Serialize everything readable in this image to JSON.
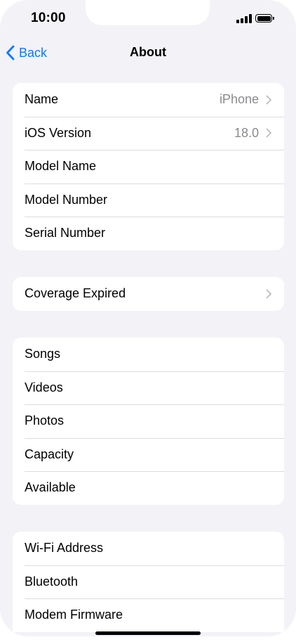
{
  "status_bar": {
    "time": "10:00"
  },
  "nav": {
    "back_label": "Back",
    "title": "About"
  },
  "groups": [
    {
      "rows": [
        {
          "label": "Name",
          "value": "iPhone",
          "chevron": true
        },
        {
          "label": "iOS Version",
          "value": "18.0",
          "chevron": true
        },
        {
          "label": "Model Name",
          "value": "",
          "chevron": false
        },
        {
          "label": "Model Number",
          "value": "",
          "chevron": false
        },
        {
          "label": "Serial Number",
          "value": "",
          "chevron": false
        }
      ]
    },
    {
      "rows": [
        {
          "label": "Coverage Expired",
          "value": "",
          "chevron": true
        }
      ]
    },
    {
      "rows": [
        {
          "label": "Songs",
          "value": "",
          "chevron": false
        },
        {
          "label": "Videos",
          "value": "",
          "chevron": false
        },
        {
          "label": "Photos",
          "value": "",
          "chevron": false
        },
        {
          "label": "Capacity",
          "value": "",
          "chevron": false
        },
        {
          "label": "Available",
          "value": "",
          "chevron": false
        }
      ]
    },
    {
      "rows": [
        {
          "label": "Wi-Fi Address",
          "value": "",
          "chevron": false
        },
        {
          "label": "Bluetooth",
          "value": "",
          "chevron": false
        },
        {
          "label": "Modem Firmware",
          "value": "",
          "chevron": false
        }
      ]
    }
  ],
  "colors": {
    "accent": "#0a7aff",
    "background": "#f2f2f7",
    "secondary_text": "#8a8a8e"
  }
}
